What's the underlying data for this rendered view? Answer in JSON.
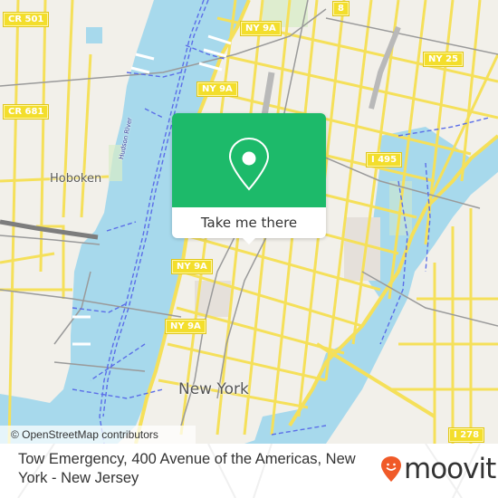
{
  "map": {
    "attribution": "© OpenStreetMap contributors",
    "colors": {
      "water": "#a7d9ec",
      "land": "#f2f0ea",
      "road": "#f5e05a",
      "rail": "#9a9a9a",
      "ferry": "#5b6ee8",
      "park": "#d8ecc8"
    },
    "place_labels": [
      {
        "id": "hoboken",
        "text": "Hoboken"
      },
      {
        "id": "new-york",
        "text": "New York"
      },
      {
        "id": "hudson-river",
        "text": "Hudson River"
      }
    ],
    "road_shields": [
      {
        "id": "cr501",
        "text": "CR 501"
      },
      {
        "id": "cr681",
        "text": "CR 681"
      },
      {
        "id": "ny9a-1",
        "text": "NY 9A"
      },
      {
        "id": "ny9a-2",
        "text": "NY 9A"
      },
      {
        "id": "ny9a-3",
        "text": "NY 9A"
      },
      {
        "id": "ny9a-4",
        "text": "NY 9A"
      },
      {
        "id": "r8",
        "text": "8"
      },
      {
        "id": "ny25",
        "text": "NY 25"
      },
      {
        "id": "i495",
        "text": "I 495"
      },
      {
        "id": "i278",
        "text": "I 278"
      }
    ]
  },
  "popup": {
    "icon": "location-pin-icon",
    "button_label": "Take me there",
    "accent_color": "#1dba6a"
  },
  "footer": {
    "title": "Tow Emergency, 400 Avenue of the Americas, New York - New Jersey",
    "brand": "moovit",
    "brand_icon": "moovit-logo-icon",
    "brand_color": "#f05a28"
  }
}
